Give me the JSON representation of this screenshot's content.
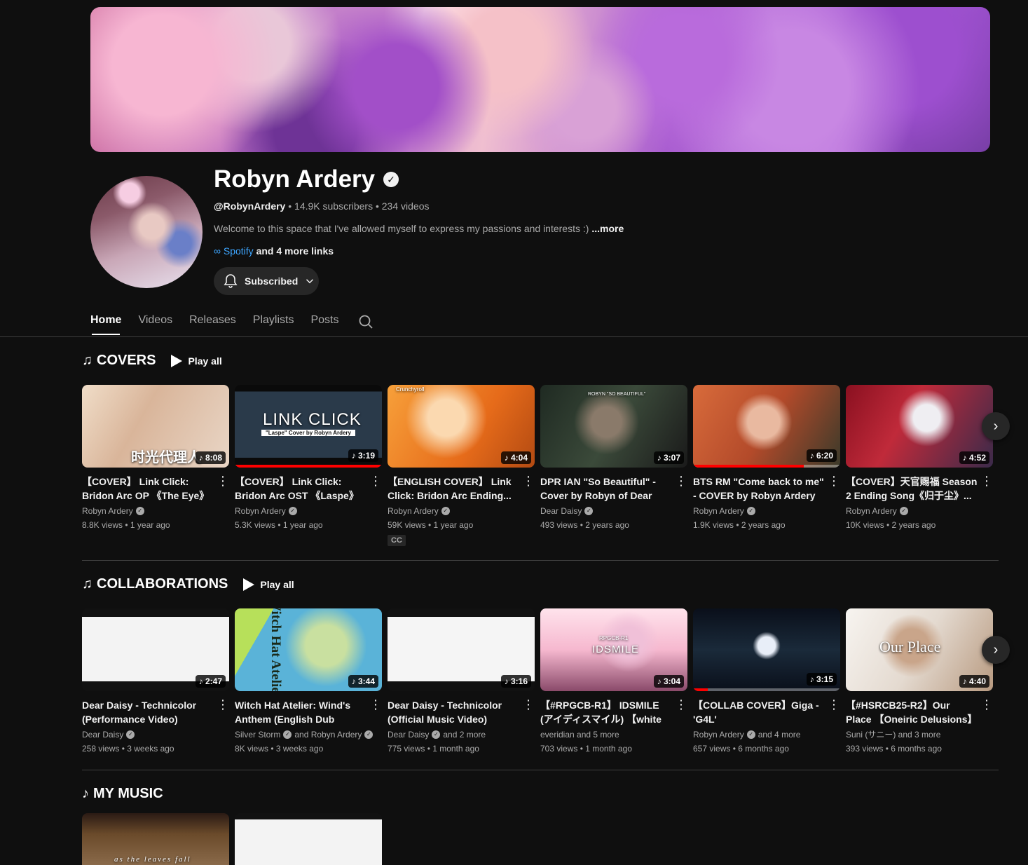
{
  "channel": {
    "name": "Robyn Ardery",
    "handle": "@RobynArdery",
    "stats": "14.9K subscribers • 234 videos",
    "description": "Welcome to this space that I've allowed myself to express my passions and interests :)",
    "more_label": "...more",
    "link_label": "Spotify",
    "links_more": "and 4 more links",
    "subscribe_label": "Subscribed"
  },
  "tabs": [
    "Home",
    "Videos",
    "Releases",
    "Playlists",
    "Posts"
  ],
  "sections": {
    "covers": {
      "title": "COVERS",
      "play_all": "Play all",
      "videos": [
        {
          "title": "【COVER】 Link Click: Bridon Arc OP 《The Eye》 by 白鲨...",
          "channel": "Robyn Ardery",
          "stats": "8.8K views • 1 year ago",
          "duration": "8:08",
          "thumb_text": "时光代理人"
        },
        {
          "title": "【COVER】 Link Click: Bridon Arc OST 《Laspe》 by ...",
          "channel": "Robyn Ardery",
          "stats": "5.3K views • 1 year ago",
          "duration": "3:19",
          "thumb_text": "LINK CLICK",
          "thumb_sub": "\"Laspe\" Cover by Robyn Ardery",
          "progress": 1.0
        },
        {
          "title": "【ENGLISH COVER】 Link Click: Bridon Arc Ending...",
          "channel": "Robyn Ardery",
          "stats": "59K views • 1 year ago",
          "duration": "4:04",
          "badge": "CC",
          "thumb_text": "Crunchyroll"
        },
        {
          "title": "DPR IAN \"So Beautiful\" - Cover by Robyn of Dear Daisy",
          "channel": "Dear Daisy",
          "stats": "493 views • 2 years ago",
          "duration": "3:07",
          "thumb_text": "ROBYN \"SO BEAUTIFUL\""
        },
        {
          "title": "BTS RM \"Come back to me\" - COVER by Robyn Ardery",
          "channel": "Robyn Ardery",
          "stats": "1.9K views • 2 years ago",
          "duration": "6:20",
          "progress": 0.75
        },
        {
          "title": "【COVER】天官赐福 Season 2 Ending Song《归于尘》...",
          "channel": "Robyn Ardery",
          "stats": "10K views • 2 years ago",
          "duration": "4:52"
        }
      ]
    },
    "collabs": {
      "title": "COLLABORATIONS",
      "play_all": "Play all",
      "videos": [
        {
          "title": "Dear Daisy - Technicolor (Performance Video)",
          "channel": "Dear Daisy",
          "stats": "258 views • 3 weeks ago",
          "duration": "2:47"
        },
        {
          "title": "Witch Hat Atelier: Wind's Anthem (English Dub Cover...",
          "channel": "Silver Storm",
          "channel_extra": "and Robyn Ardery",
          "stats": "8K views • 3 weeks ago",
          "duration": "3:44",
          "thumb_text": "Witch Hat Atelier"
        },
        {
          "title": "Dear Daisy - Technicolor (Official Music Video)",
          "channel": "Dear Daisy",
          "channel_extra": "and 2 more",
          "stats": "775 views • 1 month ago",
          "duration": "3:16"
        },
        {
          "title": "【#RPGCB-R1】 IDSMILE (アイディスマイル) 【white ...",
          "channel": "everidian and 5 more",
          "stats": "703 views • 1 month ago",
          "duration": "3:04",
          "thumb_text": "IDSMILE",
          "thumb_sub": "RPGCB-R1"
        },
        {
          "title": "【COLLAB COVER】Giga - 'G4L'",
          "channel": "Robyn Ardery",
          "channel_extra": "and 4 more",
          "stats": "657 views • 6 months ago",
          "duration": "3:15",
          "progress": 0.1
        },
        {
          "title": "【#HSRCB25-R2】Our Place 【Oneiric Delusions】",
          "channel": "Suni (サニー) and 3 more",
          "stats": "393 views • 6 months ago",
          "duration": "4:40",
          "thumb_text": "Our Place"
        }
      ]
    },
    "music": {
      "title": "MY MUSIC",
      "thumb_text": "as the leaves fall"
    }
  },
  "colors": {
    "background": "#0f0f0f",
    "accent_link": "#3ea6ff",
    "progress": "#ff0000"
  }
}
